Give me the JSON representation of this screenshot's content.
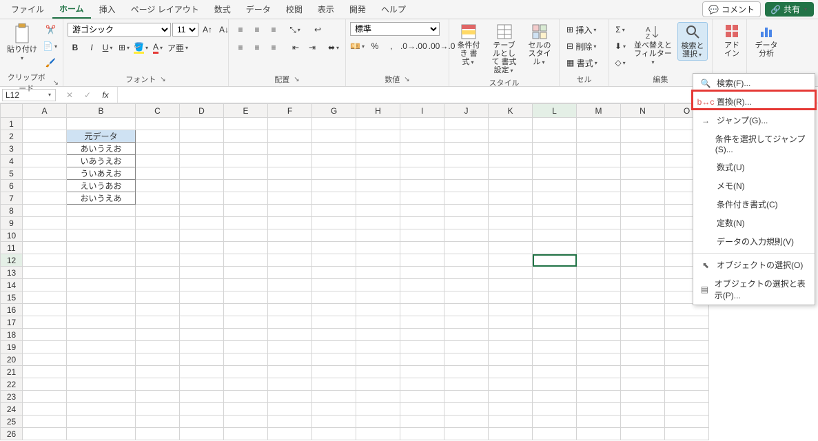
{
  "tabs": {
    "items": [
      "ファイル",
      "ホーム",
      "挿入",
      "ページ レイアウト",
      "数式",
      "データ",
      "校閲",
      "表示",
      "開発",
      "ヘルプ"
    ],
    "active": 1
  },
  "topright": {
    "comment": "コメント",
    "share": "共有"
  },
  "ribbon": {
    "clipboard": {
      "paste": "貼り付け",
      "label": "クリップボード"
    },
    "font": {
      "name": "游ゴシック",
      "size": "11",
      "label": "フォント"
    },
    "align": {
      "label": "配置"
    },
    "number": {
      "style": "標準",
      "label": "数値"
    },
    "styles": {
      "cond": "条件付き\n書式",
      "tbl": "テーブルとして\n書式設定",
      "cell": "セルの\nスタイル",
      "label": "スタイル"
    },
    "cells": {
      "ins": "挿入",
      "del": "削除",
      "fmt": "書式",
      "label": "セル"
    },
    "editing": {
      "sort": "並べ替えと\nフィルター",
      "find": "検索と\n選択",
      "label": "編集"
    },
    "addin": {
      "lbl": "アド\nイン",
      "label": "アドイン"
    },
    "analysis": {
      "lbl": "データ\n分析",
      "label": "分析"
    }
  },
  "namebox": "L12",
  "columns": [
    "A",
    "B",
    "C",
    "D",
    "E",
    "F",
    "G",
    "H",
    "I",
    "J",
    "K",
    "L",
    "M",
    "N",
    "O"
  ],
  "data_header": "元データ",
  "data_rows": [
    "あいうえお",
    "いあうえお",
    "ういあえお",
    "えいうあお",
    "おいうえあ"
  ],
  "selected": {
    "row": 12,
    "col": "L"
  },
  "menu": [
    {
      "icon": "search",
      "label": "検索(F)..."
    },
    {
      "icon": "replace",
      "label": "置換(R)..."
    },
    {
      "icon": "goto",
      "label": "ジャンプ(G)..."
    },
    {
      "icon": "",
      "label": "条件を選択してジャンプ(S)..."
    },
    {
      "icon": "",
      "label": "数式(U)"
    },
    {
      "icon": "",
      "label": "メモ(N)"
    },
    {
      "icon": "",
      "label": "条件付き書式(C)"
    },
    {
      "icon": "",
      "label": "定数(N)"
    },
    {
      "icon": "",
      "label": "データの入力規則(V)"
    },
    {
      "icon": "pointer",
      "label": "オブジェクトの選択(O)"
    },
    {
      "icon": "pane",
      "label": "オブジェクトの選択と表示(P)..."
    }
  ]
}
